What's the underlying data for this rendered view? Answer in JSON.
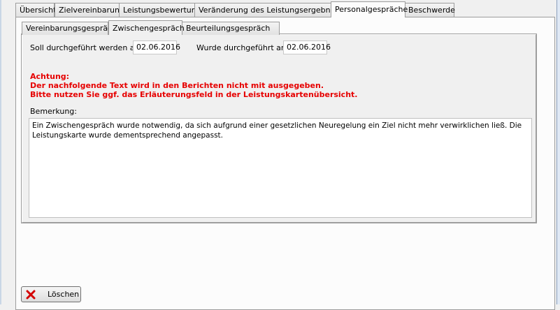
{
  "outer_tabs": [
    {
      "label": "Übersicht"
    },
    {
      "label": "Zielvereinbarung"
    },
    {
      "label": "Leistungsbewertung"
    },
    {
      "label": "Veränderung des Leistungsergebnisses"
    },
    {
      "label": "Personalgespräche"
    },
    {
      "label": "Beschwerde"
    }
  ],
  "inner_tabs": [
    {
      "label": "Vereinbarungsgespräch"
    },
    {
      "label": "Zwischengespräch"
    },
    {
      "label": "Beurteilungsgespräch"
    }
  ],
  "form": {
    "planned_label": "Soll durchgeführt werden am:",
    "planned_date": "02.06.2016",
    "done_label": "Wurde durchgeführt am:",
    "done_date": "02.06.2016"
  },
  "warning": {
    "line1": "Achtung:",
    "line2": "Der nachfolgende Text wird in den Berichten nicht mit ausgegeben.",
    "line3": "Bitte nutzen Sie ggf. das Erläuterungsfeld in der Leistungskartenübersicht."
  },
  "remark": {
    "label": "Bemerkung:",
    "text": "Ein Zwischengespräch wurde notwendig, da sich aufgrund einer gesetzlichen Neuregelung ein Ziel nicht mehr verwirklichen ließ. Die Leistungskarte wurde dementsprechend angepasst."
  },
  "buttons": {
    "delete_label": "Löschen"
  },
  "colors": {
    "warning": "#e60000"
  }
}
